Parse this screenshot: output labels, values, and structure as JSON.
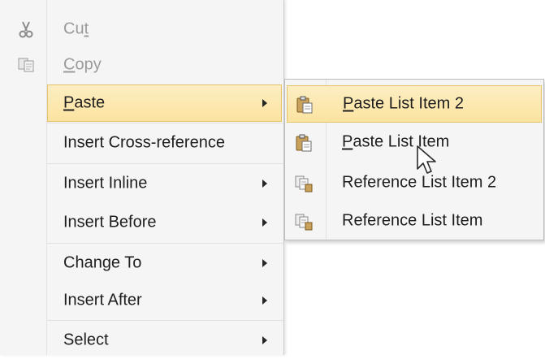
{
  "context_menu": {
    "items": [
      {
        "pre": "Cu",
        "ul": "t",
        "post": "",
        "disabled": true,
        "icon": "scissors-icon"
      },
      {
        "pre": "",
        "ul": "C",
        "post": "opy",
        "disabled": true,
        "icon": "copy-icon"
      },
      {
        "pre": "",
        "ul": "P",
        "post": "aste",
        "submenu": true,
        "highlighted": true
      },
      {
        "label": "Insert Cross-reference"
      },
      {
        "label": "Insert Inline",
        "submenu": true
      },
      {
        "label": "Insert Before",
        "submenu": true
      },
      {
        "label": "Change To",
        "submenu": true
      },
      {
        "label": "Insert After",
        "submenu": true
      },
      {
        "label": "Select",
        "submenu": true
      }
    ]
  },
  "paste_submenu": {
    "items": [
      {
        "pre": "",
        "ul": "P",
        "post": "aste List Item 2",
        "icon": "paste-clipboard-icon",
        "highlighted": true
      },
      {
        "pre": "",
        "ul": "P",
        "post": "aste List Item",
        "icon": "paste-clipboard-icon"
      },
      {
        "pre": "Reference List Item 2",
        "ul": "",
        "post": "",
        "icon": "paste-reference-icon"
      },
      {
        "pre": "Reference List Item",
        "ul": "",
        "post": "",
        "icon": "paste-reference-icon"
      }
    ]
  },
  "colors": {
    "menu_bg": "#f5f5f5",
    "highlight_top": "#fdeec2",
    "highlight_bottom": "#fbe3a0",
    "highlight_border": "#e6c26c",
    "disabled_text": "#9a9a9a"
  }
}
